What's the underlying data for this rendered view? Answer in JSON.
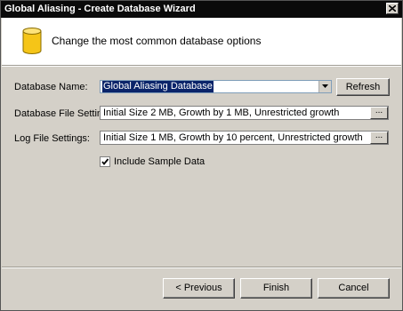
{
  "window": {
    "title": "Global Aliasing - Create Database Wizard"
  },
  "header": {
    "icon": "database-icon",
    "text": "Change the most common database options"
  },
  "form": {
    "database_name_label": "Database Name:",
    "database_name_value": "Global Aliasing Database",
    "refresh_label": "Refresh",
    "database_file_label": "Database File Settings:",
    "database_file_value": "Initial Size 2 MB, Growth by 1 MB,  Unrestricted growth",
    "log_file_label": "Log File Settings:",
    "log_file_value": "Initial Size 1 MB, Growth by 10 percent,  Unrestricted growth",
    "ellipsis_label": "...",
    "include_sample_label": "Include Sample Data",
    "include_sample_checked": true
  },
  "footer": {
    "previous_label": "< Previous",
    "finish_label": "Finish",
    "cancel_label": "Cancel"
  },
  "colors": {
    "titlebar": "#0a0a0a",
    "dialog_bg": "#d4d0c8",
    "selection": "#0a246a",
    "db_icon_fill": "#f5c518"
  }
}
